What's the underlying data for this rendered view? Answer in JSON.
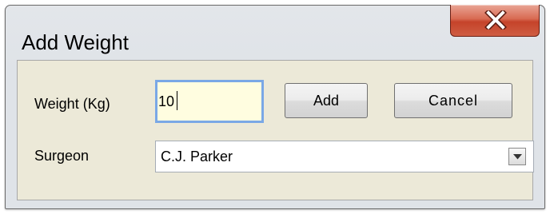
{
  "window": {
    "title": "Add Weight",
    "close_icon": "close-x-icon"
  },
  "form": {
    "weight_label": "Weight (Kg)",
    "weight_value": "10",
    "add_label": "Add",
    "cancel_label": "Cancel",
    "surgeon_label": "Surgeon",
    "surgeon_value": "C.J. Parker",
    "dropdown_icon": "chevron-down-icon"
  },
  "colors": {
    "close_button": "#c5432a",
    "focus_border": "#7aa8e6",
    "input_background": "#fffde0",
    "dialog_background": "#ece9d8"
  }
}
